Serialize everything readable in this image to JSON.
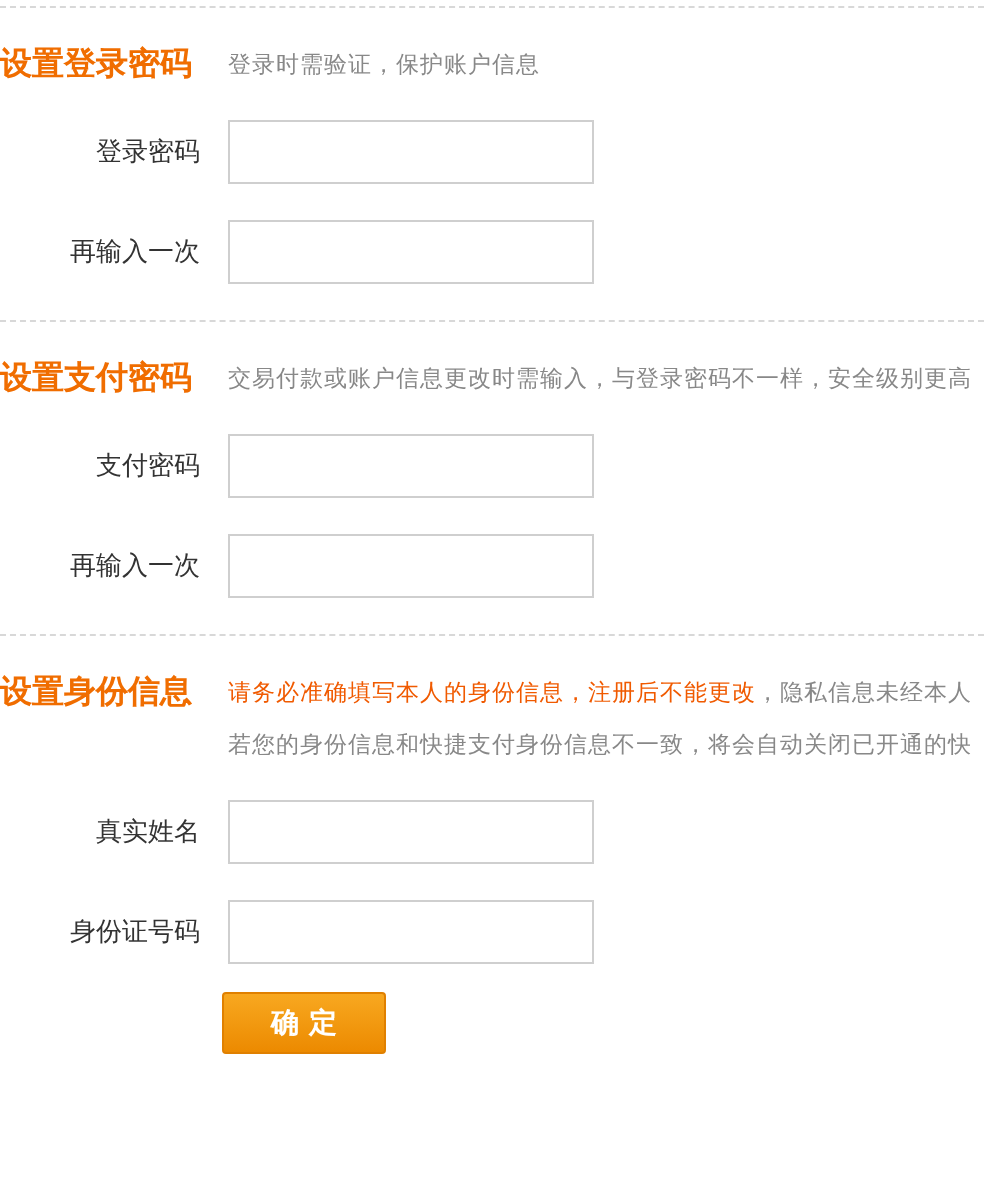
{
  "sections": [
    {
      "title": "设置登录密码",
      "hint_lines": [
        [
          {
            "kind": "plain",
            "text": "登录时需验证，保护账户信息"
          }
        ]
      ],
      "fields": [
        {
          "label": "登录密码"
        },
        {
          "label": "再输入一次"
        }
      ]
    },
    {
      "title": "设置支付密码",
      "hint_lines": [
        [
          {
            "kind": "plain",
            "text": "交易付款或账户信息更改时需输入，与登录密码不一样，安全级别更高"
          }
        ]
      ],
      "fields": [
        {
          "label": "支付密码"
        },
        {
          "label": "再输入一次"
        }
      ]
    },
    {
      "title": "设置身份信息",
      "hint_lines": [
        [
          {
            "kind": "warning",
            "text": "请务必准确填写本人的身份信息，注册后不能更改"
          },
          {
            "kind": "plain",
            "text": "，隐私信息未经本人"
          }
        ],
        [
          {
            "kind": "plain",
            "text": "若您的身份信息和快捷支付身份信息不一致，将会自动关闭已开通的快"
          }
        ]
      ],
      "fields": [
        {
          "label": "真实姓名"
        },
        {
          "label": "身份证号码"
        }
      ]
    }
  ],
  "submit_button": "确 定"
}
